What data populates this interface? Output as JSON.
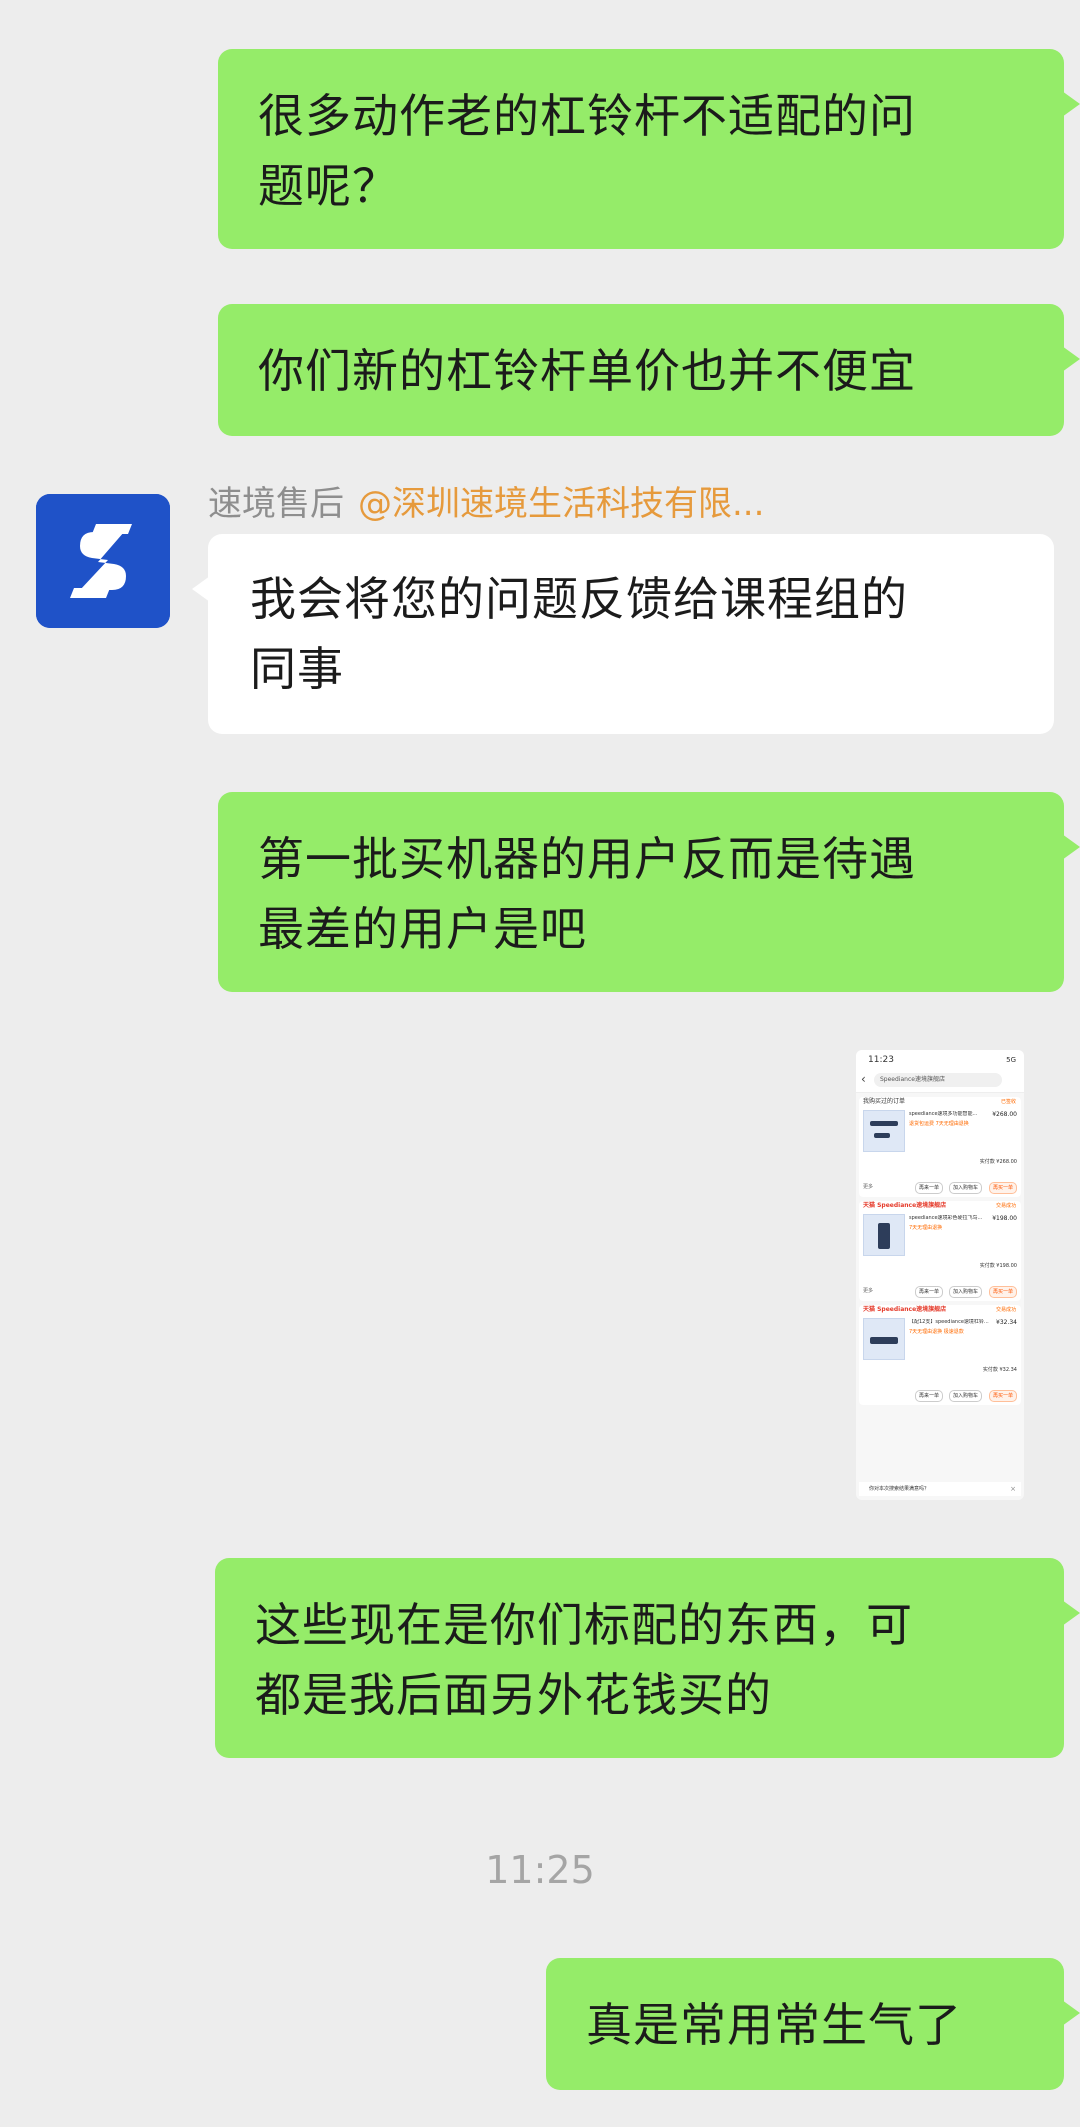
{
  "messages": {
    "m1": {
      "lines": [
        "很多动作老的杠铃杆不适配的问",
        "题呢？"
      ]
    },
    "m2": {
      "lines": [
        "你们新的杠铃杆单价也并不便宜"
      ]
    },
    "m3": {
      "lines": [
        "我会将您的问题反馈给课程组的",
        "同事"
      ]
    },
    "m4": {
      "lines": [
        "第一批买机器的用户反而是待遇",
        "最差的用户是吧"
      ]
    },
    "m5": {
      "lines": [
        "这些现在是你们标配的东西，可",
        "都是我后面另外花钱买的"
      ]
    },
    "m6": {
      "lines": [
        "真是常用常生气了"
      ]
    }
  },
  "sender": {
    "name": "速境售后",
    "org": "@深圳速境生活科技有限..."
  },
  "timestamp": "11:25",
  "screenshot": {
    "time": "11:23",
    "net": "5G",
    "search": "Speediance速境旗舰店",
    "cards": [
      {
        "shop": "我购买过的订单",
        "status": "已签收",
        "title": "speediance速境多功能智能...",
        "price": "¥268.00",
        "tag": "退货包运费 7天无理由退换",
        "paid": "实付款 ¥268.00",
        "more": "更多",
        "btn1": "再来一单",
        "btn2": "加入购物车",
        "btn3": "再买一单"
      },
      {
        "shop": "天猫 Speediance速境旗舰店",
        "status": "交易成功",
        "title": "speediance速境彩色硬拉飞鸟...",
        "price": "¥198.00",
        "tag": "7天无理由退换",
        "paid": "实付款 ¥198.00",
        "more": "更多",
        "btn1": "再来一单",
        "btn2": "加入购物车",
        "btn3": "再买一单"
      },
      {
        "shop": "天猫 Speediance速境旗舰店",
        "status": "交易成功",
        "title": "【配12支】speediance速境杠铃...",
        "price": "¥32.34",
        "tag": "7天无理由退换 极速退款",
        "paid": "实付款 ¥32.34",
        "more": "",
        "btn1": "再来一单",
        "btn2": "加入购物车",
        "btn3": "再买一单"
      }
    ],
    "survey": "你对本次搜索结果满意吗？"
  }
}
